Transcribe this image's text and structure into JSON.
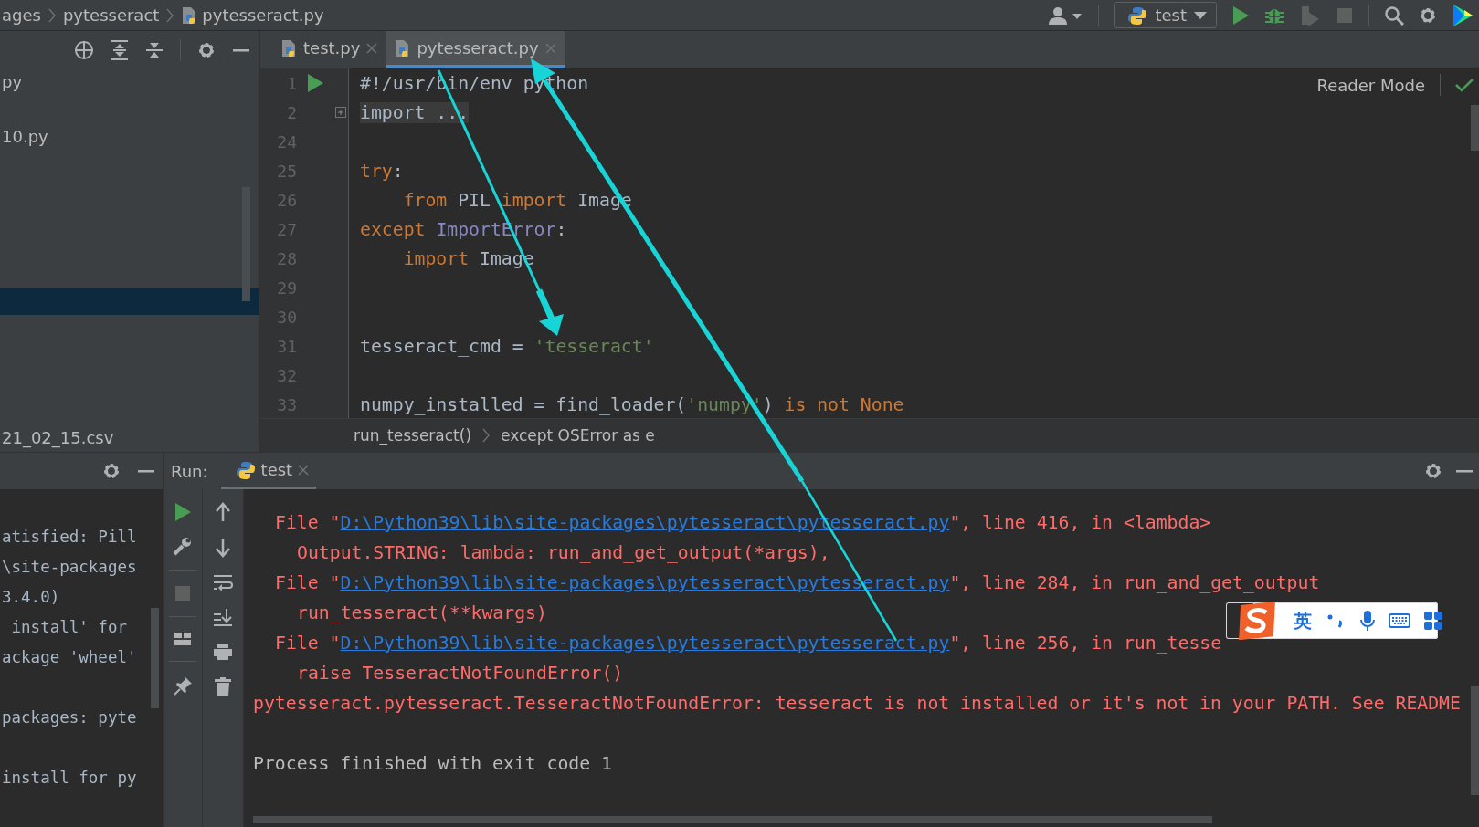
{
  "breadcrumbs": [
    {
      "label": "ages",
      "kind": "folder"
    },
    {
      "label": "pytesseract",
      "kind": "folder"
    },
    {
      "label": "pytesseract.py",
      "kind": "file"
    }
  ],
  "run_config": {
    "label": "test"
  },
  "project_panel": {
    "items": [
      {
        "label": "py",
        "selected": false
      },
      {
        "label": "10.py",
        "selected": false
      },
      {
        "selected": true
      },
      {
        "label": "21_02_15.csv",
        "selected": false
      }
    ]
  },
  "editor_tabs": [
    {
      "label": "test.py",
      "selected": false
    },
    {
      "label": "pytesseract.py",
      "selected": true
    }
  ],
  "editor": {
    "reader_mode": "Reader Mode",
    "lines": [
      {
        "num": "1",
        "run": true,
        "tokens": [
          {
            "t": "#!/usr/bin/env python",
            "kind": "plain"
          }
        ]
      },
      {
        "num": "2",
        "folded": true,
        "tokens": [
          {
            "t": "import ...",
            "kind": "folded"
          }
        ]
      },
      {
        "num": "24"
      },
      {
        "num": "25",
        "tokens": [
          {
            "t": "try",
            "kind": "keyword"
          },
          {
            "t": ":",
            "kind": "plain"
          }
        ]
      },
      {
        "num": "26",
        "tokens": [
          {
            "t": "    from ",
            "kind": "keyword"
          },
          {
            "t": "PIL ",
            "kind": "plain"
          },
          {
            "t": "import ",
            "kind": "keyword"
          },
          {
            "t": "Image",
            "kind": "plain"
          }
        ]
      },
      {
        "num": "27",
        "tokens": [
          {
            "t": "except ",
            "kind": "keyword"
          },
          {
            "t": "ImportError",
            "kind": "builtin"
          },
          {
            "t": ":",
            "kind": "plain"
          }
        ]
      },
      {
        "num": "28",
        "tokens": [
          {
            "t": "    import ",
            "kind": "keyword"
          },
          {
            "t": "Image",
            "kind": "plain"
          }
        ]
      },
      {
        "num": "29"
      },
      {
        "num": "30"
      },
      {
        "num": "31",
        "tokens": [
          {
            "t": "tesseract_cmd = ",
            "kind": "plain"
          },
          {
            "t": "'tesseract'",
            "kind": "string"
          }
        ]
      },
      {
        "num": "32"
      },
      {
        "num": "33",
        "tokens": [
          {
            "t": "numpy_installed = find_loader(",
            "kind": "plain"
          },
          {
            "t": "'numpy'",
            "kind": "string"
          },
          {
            "t": ") ",
            "kind": "plain"
          },
          {
            "t": "is not None",
            "kind": "keyword"
          }
        ]
      }
    ],
    "path": [
      "run_tesseract()",
      "except OSError as e"
    ]
  },
  "left_console": {
    "lines": [
      {
        "kind": "text",
        "text": "atisfied: Pill"
      },
      {
        "kind": "text",
        "text": "\\site-packages"
      },
      {
        "kind": "text",
        "text": "3.4.0)"
      },
      {
        "kind": "text",
        "text": " install' for"
      },
      {
        "kind": "text",
        "text": "ackage 'wheel'"
      },
      {
        "kind": "blank"
      },
      {
        "kind": "text",
        "text": "packages: pyte"
      },
      {
        "kind": "blank"
      },
      {
        "kind": "text",
        "text": "install for py"
      }
    ]
  },
  "run_panel": {
    "label": "Run:",
    "tabs": [
      {
        "label": "test",
        "selected": true
      }
    ],
    "lines": [
      {
        "kind": "trace",
        "pre": "File \"",
        "link": "D:\\Python39\\lib\\site-packages\\pytesseract\\pytesseract.py",
        "post": "\", line 416, in <lambda>"
      },
      {
        "kind": "detail",
        "text": "Output.STRING: lambda: run_and_get_output(*args),"
      },
      {
        "kind": "trace",
        "pre": "File \"",
        "link": "D:\\Python39\\lib\\site-packages\\pytesseract\\pytesseract.py",
        "post": "\", line 284, in run_and_get_output"
      },
      {
        "kind": "detail",
        "text": "run_tesseract(**kwargs)"
      },
      {
        "kind": "trace",
        "pre": "File \"",
        "link": "D:\\Python39\\lib\\site-packages\\pytesseract\\pytesseract.py",
        "post": "\", line 256, in run_tesse"
      },
      {
        "kind": "detail",
        "text": "raise TesseractNotFoundError()"
      },
      {
        "kind": "error",
        "text": "pytesseract.pytesseract.TesseractNotFoundError: tesseract is not installed or it's not in your PATH. See README"
      },
      {
        "kind": "blank"
      },
      {
        "kind": "plain",
        "text": "Process finished with exit code 1"
      }
    ]
  },
  "ime_toolbar": {
    "language": "英"
  }
}
